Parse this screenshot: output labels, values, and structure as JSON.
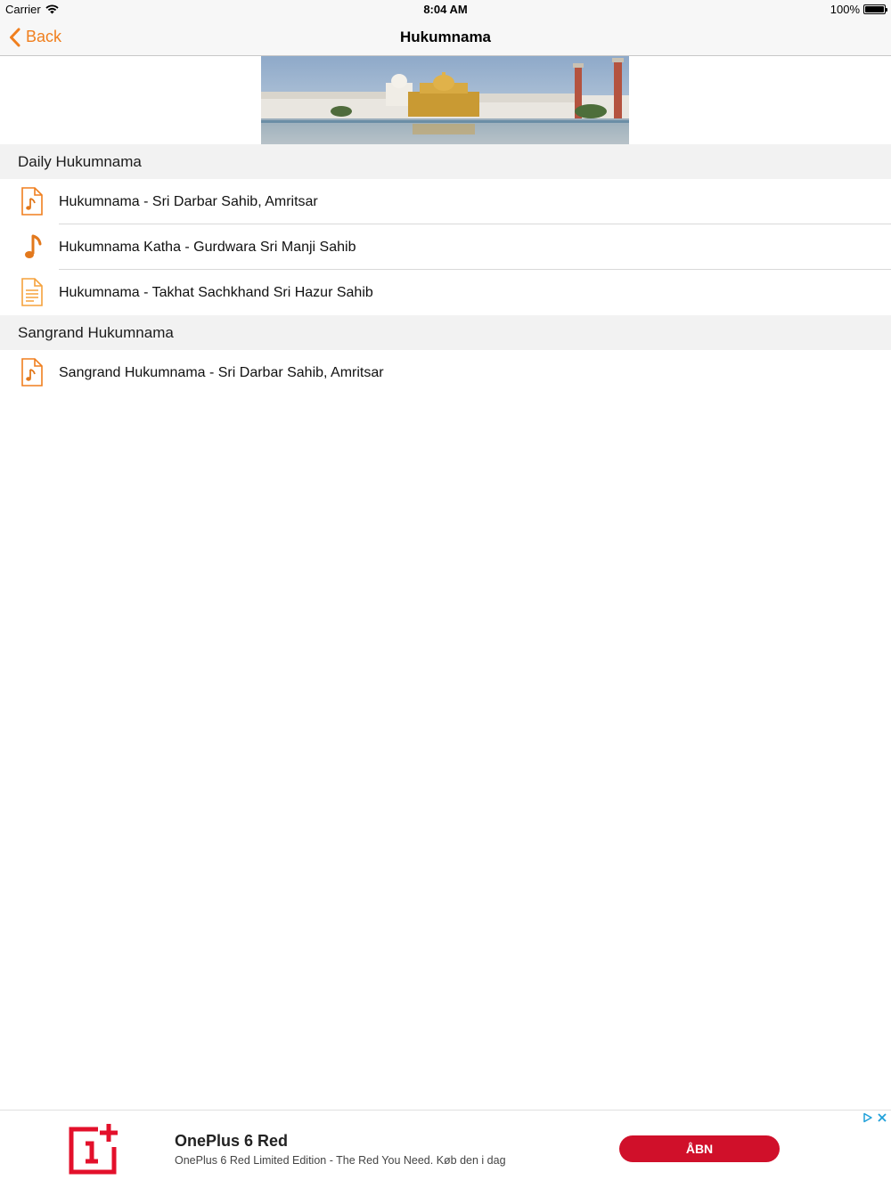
{
  "status": {
    "carrier": "Carrier",
    "time": "8:04 AM",
    "battery": "100%"
  },
  "nav": {
    "back_label": "Back",
    "title": "Hukumnama"
  },
  "sections": [
    {
      "header": "Daily Hukumnama",
      "rows": [
        {
          "label": "Hukumnama - Sri Darbar Sahib, Amritsar",
          "icon": "audio-file-icon"
        },
        {
          "label": "Hukumnama Katha - Gurdwara Sri Manji Sahib",
          "icon": "music-note-icon"
        },
        {
          "label": "Hukumnama - Takhat Sachkhand Sri Hazur Sahib",
          "icon": "text-file-icon"
        }
      ]
    },
    {
      "header": "Sangrand Hukumnama",
      "rows": [
        {
          "label": "Sangrand Hukumnama - Sri Darbar Sahib, Amritsar",
          "icon": "audio-file-icon"
        }
      ]
    }
  ],
  "ad": {
    "title": "OnePlus 6 Red",
    "subtitle": "OnePlus 6 Red Limited Edition - The Red You Need. Køb den i dag",
    "cta": "ÅBN"
  },
  "colors": {
    "accent": "#f07f1e",
    "ad_red": "#d0102a"
  }
}
